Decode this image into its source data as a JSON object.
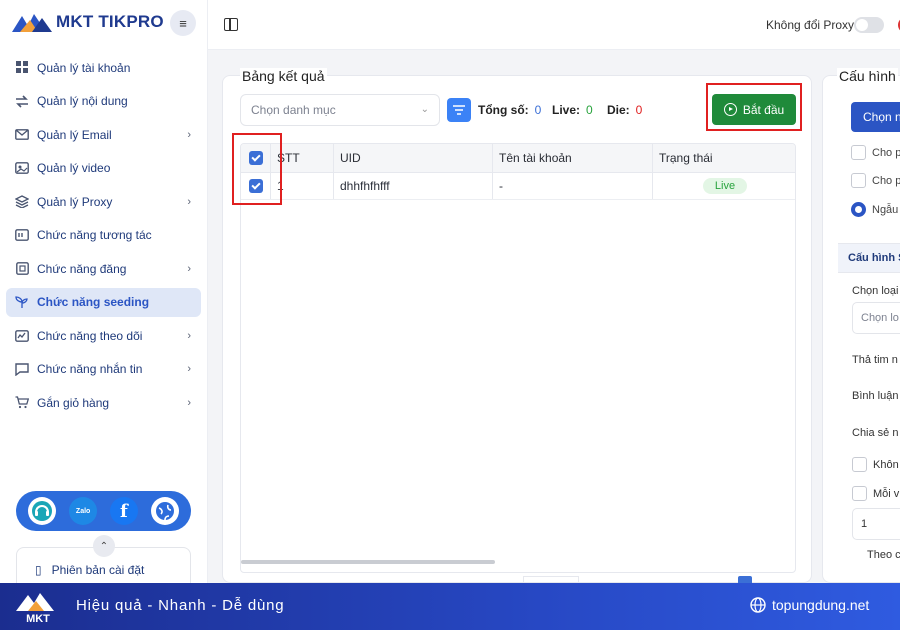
{
  "brand": {
    "name": "MKT TIKPRO"
  },
  "sidebar": {
    "items": [
      {
        "label": "Quản lý tài khoản",
        "icon": "grid-icon",
        "chevron": false,
        "active": false
      },
      {
        "label": "Quản lý nội dung",
        "icon": "swap-icon",
        "chevron": false,
        "active": false
      },
      {
        "label": "Quản lý Email",
        "icon": "mail-icon",
        "chevron": true,
        "active": false
      },
      {
        "label": "Quản lý video",
        "icon": "video-icon",
        "chevron": false,
        "active": false
      },
      {
        "label": "Quản lý Proxy",
        "icon": "layers-icon",
        "chevron": true,
        "active": false
      },
      {
        "label": "Chức năng tương tác",
        "icon": "chat-box-icon",
        "chevron": false,
        "active": false
      },
      {
        "label": "Chức năng đăng",
        "icon": "post-icon",
        "chevron": true,
        "active": false
      },
      {
        "label": "Chức năng seeding",
        "icon": "sprout-icon",
        "chevron": false,
        "active": true
      },
      {
        "label": "Chức năng theo dõi",
        "icon": "follow-icon",
        "chevron": true,
        "active": false
      },
      {
        "label": "Chức năng nhắn tin",
        "icon": "message-icon",
        "chevron": true,
        "active": false
      },
      {
        "label": "Gắn giỏ hàng",
        "icon": "cart-icon",
        "chevron": true,
        "active": false
      }
    ],
    "social": {
      "zalo": "Zalo"
    },
    "version_label": "Phiên bản cài đặt"
  },
  "topbar": {
    "proxy_label": "Không đổi Proxy"
  },
  "results": {
    "title": "Bảng kết quả",
    "category_placeholder": "Chọn danh mục",
    "stats": {
      "total_label": "Tổng số:",
      "total": "0",
      "live_label": "Live:",
      "live": "0",
      "die_label": "Die:",
      "die": "0"
    },
    "start_label": "Bắt đầu",
    "columns": [
      "STT",
      "UID",
      "Tên tài khoản",
      "Trạng thái"
    ],
    "rows": [
      {
        "stt": "1",
        "uid": "dhhfhfhfff",
        "name": "-",
        "status": "Live"
      }
    ]
  },
  "config": {
    "title": "Cấu hình",
    "button_label": "Chọn n",
    "options": [
      "Cho p",
      "Cho p",
      "Ngẫu"
    ],
    "section_label": "Cấu hình S",
    "type_label": "Chọn loại",
    "type_placeholder": "Chọn lo",
    "like_label": "Thả tim n",
    "comment_label": "Bình luận",
    "share_label": "Chia sẻ n",
    "opt_none": "Khôn",
    "opt_each": "Mỗi v",
    "value": "1",
    "theo_label": "Theo c"
  },
  "banner": {
    "logo_text": "MKT",
    "slogan": "Hiệu quả - Nhanh  - Dễ dùng",
    "site": "topungdung.net"
  },
  "colors": {
    "accent": "#2b55c4",
    "start_button": "#1f8a3a",
    "highlight": "#e02020",
    "banner": "#2748c4"
  }
}
